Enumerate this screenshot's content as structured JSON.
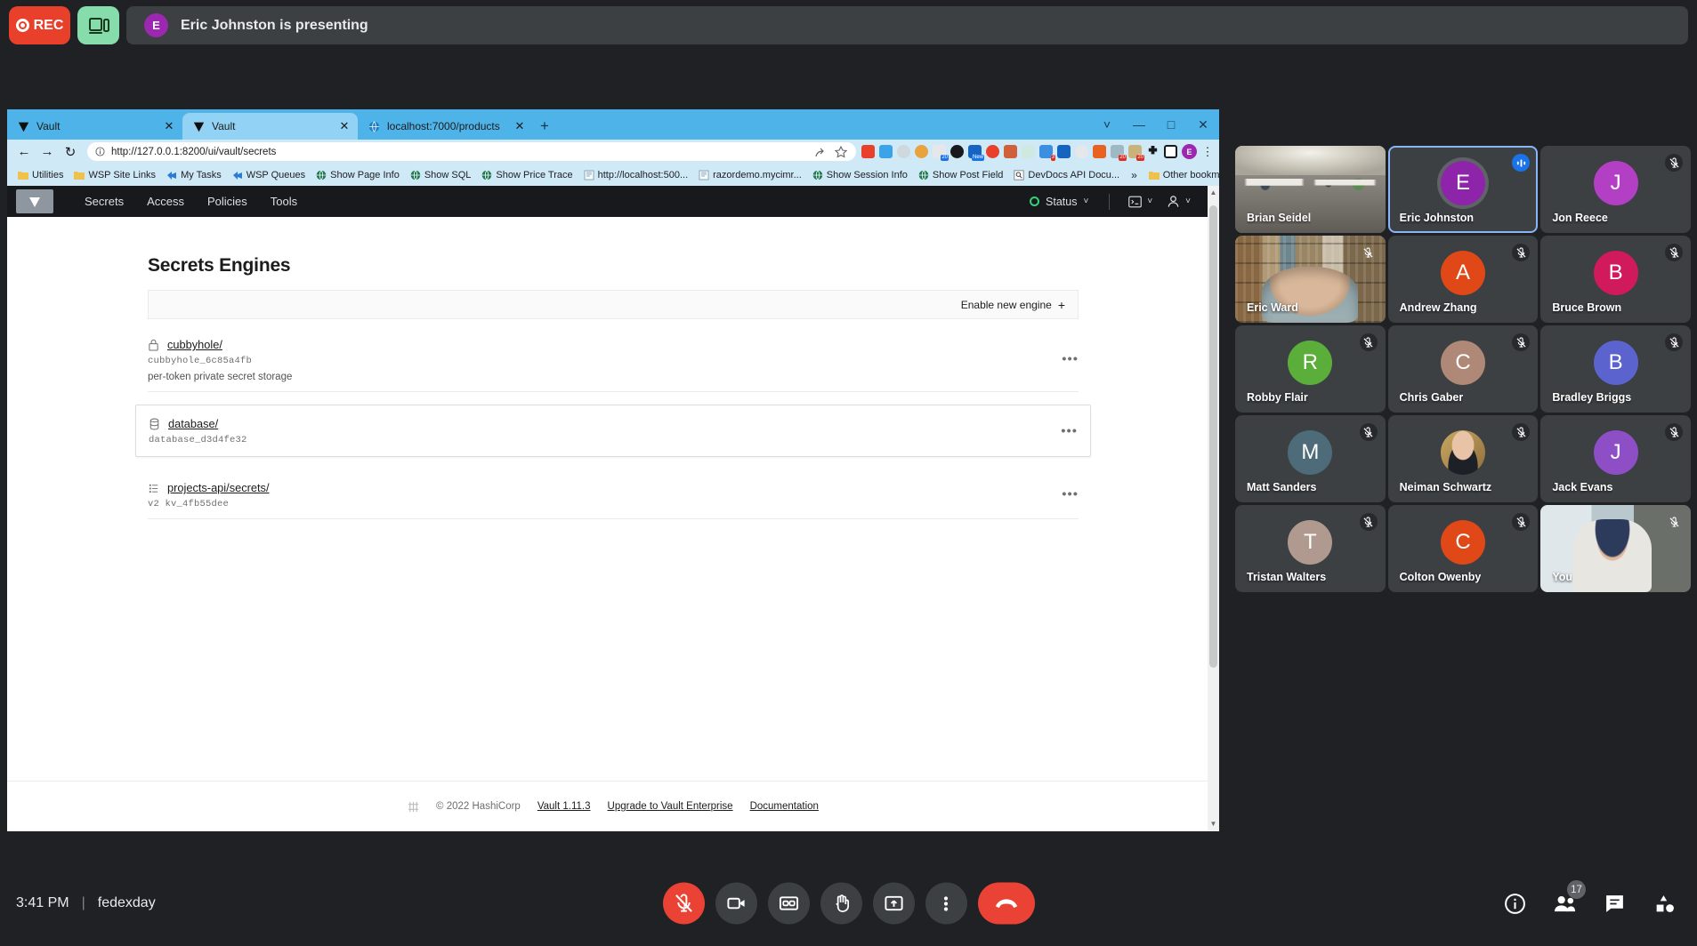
{
  "top_bar": {
    "rec_label": "REC",
    "rec_icon": "record-dot-icon",
    "present_icon": "present-screen-icon",
    "presenter_initial": "E",
    "presenting_text": "Eric Johnston is presenting",
    "rec_color": "#e8402b",
    "present_color": "#86ddab"
  },
  "browser": {
    "tabs": [
      {
        "title": "Vault",
        "favicon": "vault-logo-icon",
        "active": false
      },
      {
        "title": "Vault",
        "favicon": "vault-logo-icon",
        "active": true
      },
      {
        "title": "localhost:7000/products",
        "favicon": "globe-icon",
        "active": false
      }
    ],
    "new_tab_label": "+",
    "window_controls": [
      "chevron-down-icon",
      "minimize-icon",
      "maximize-icon",
      "close-icon"
    ],
    "nav": {
      "back_icon": "arrow-left-icon",
      "forward_icon": "arrow-right-icon",
      "reload_icon": "reload-icon"
    },
    "url": "http://127.0.0.1:8200/ui/vault/secrets",
    "url_info_icon": "info-circle-icon",
    "url_actions": [
      "share-icon",
      "bookmark-star-icon"
    ],
    "profile_initial": "E",
    "bookmarks": [
      {
        "label": "Utilities",
        "icon": "folder-icon"
      },
      {
        "label": "WSP Site Links",
        "icon": "folder-icon"
      },
      {
        "label": "My Tasks",
        "icon": "sharepoint-icon"
      },
      {
        "label": "WSP Queues",
        "icon": "sharepoint-icon"
      },
      {
        "label": "Show Page Info",
        "icon": "globe-icon"
      },
      {
        "label": "Show SQL",
        "icon": "globe-icon"
      },
      {
        "label": "Show Price Trace",
        "icon": "globe-icon"
      },
      {
        "label": "http://localhost:500...",
        "icon": "document-icon"
      },
      {
        "label": "razordemo.mycimr...",
        "icon": "document-icon"
      },
      {
        "label": "Show Session Info",
        "icon": "globe-icon"
      },
      {
        "label": "Show Post Field",
        "icon": "globe-icon"
      },
      {
        "label": "DevDocs API Docu...",
        "icon": "search-doc-icon"
      }
    ],
    "bookmarks_overflow": "»",
    "other_bookmarks": {
      "label": "Other bookmarks",
      "icon": "folder-icon"
    },
    "extension_badges": [
      "20",
      "New",
      "3",
      "20",
      "20"
    ]
  },
  "vault": {
    "logo_icon": "vault-triangle-icon",
    "nav_links": [
      "Secrets",
      "Access",
      "Policies",
      "Tools"
    ],
    "status": {
      "label": "Status",
      "dot_color": "#2fd37a",
      "chevron": "chevron-down-icon"
    },
    "console_icon": "terminal-icon",
    "user_icon": "user-icon",
    "page_title": "Secrets Engines",
    "enable_button": {
      "label": "Enable new engine",
      "plus": "+"
    },
    "engines": [
      {
        "name": "cubbyhole/",
        "icon": "lock-icon",
        "accessor": "cubbyhole_6c85a4fb",
        "description": "per-token private secret storage",
        "menu": "•••",
        "selected": false
      },
      {
        "name": "database/",
        "icon": "database-icon",
        "accessor": "database_d3d4fe32",
        "description": "",
        "menu": "•••",
        "selected": true
      },
      {
        "name": "projects-api/secrets/",
        "icon": "kv-list-icon",
        "accessor": "v2  kv_4fb55dee",
        "description": "",
        "menu": "•••",
        "selected": false
      }
    ],
    "footer": {
      "logo_icon": "hashicorp-logo-icon",
      "copyright": "© 2022 HashiCorp",
      "version": "Vault 1.11.3",
      "upgrade": "Upgrade to Vault Enterprise",
      "documentation": "Documentation"
    }
  },
  "participants": [
    {
      "name": "Brian Seidel",
      "type": "video",
      "photo": "ph-office",
      "muted": false,
      "speaking": false,
      "show_mic": false
    },
    {
      "name": "Eric Johnston",
      "type": "avatar",
      "initial": "E",
      "color": "#8e24aa",
      "speaking": true,
      "show_mic": true,
      "mic_active": true
    },
    {
      "name": "Jon Reece",
      "type": "avatar",
      "initial": "J",
      "color": "#b23fc4",
      "muted": true,
      "show_mic": true
    },
    {
      "name": "Eric Ward",
      "type": "video",
      "photo": "ph-bookshelf",
      "muted": true,
      "show_mic": true,
      "mic_on_photo": true
    },
    {
      "name": "Andrew Zhang",
      "type": "avatar",
      "initial": "A",
      "color": "#e14817",
      "muted": true,
      "show_mic": true
    },
    {
      "name": "Bruce Brown",
      "type": "avatar",
      "initial": "B",
      "color": "#d01a5b",
      "muted": true,
      "show_mic": true
    },
    {
      "name": "Robby Flair",
      "type": "avatar",
      "initial": "R",
      "color": "#5cae3a",
      "muted": true,
      "show_mic": true
    },
    {
      "name": "Chris Gaber",
      "type": "avatar",
      "initial": "C",
      "color": "#b08878",
      "muted": true,
      "show_mic": true
    },
    {
      "name": "Bradley Briggs",
      "type": "avatar",
      "initial": "B",
      "color": "#5b63cf",
      "muted": true,
      "show_mic": true
    },
    {
      "name": "Matt Sanders",
      "type": "avatar",
      "initial": "M",
      "color": "#4d6b78",
      "muted": true,
      "show_mic": true
    },
    {
      "name": "Neiman Schwartz",
      "type": "photo-avatar",
      "photo": "ph-headshot",
      "muted": true,
      "show_mic": true
    },
    {
      "name": "Jack Evans",
      "type": "avatar",
      "initial": "J",
      "color": "#8e4ec6",
      "muted": true,
      "show_mic": true
    },
    {
      "name": "Tristan Walters",
      "type": "avatar",
      "initial": "T",
      "color": "#b09a90",
      "muted": true,
      "show_mic": true
    },
    {
      "name": "Colton Owenby",
      "type": "avatar",
      "initial": "C",
      "color": "#e14817",
      "muted": true,
      "show_mic": true
    },
    {
      "name": "You",
      "type": "video",
      "photo": "ph-room",
      "muted": true,
      "show_mic": true,
      "mic_on_photo": true
    }
  ],
  "bottom_bar": {
    "time": "3:41 PM",
    "separator": "|",
    "meeting_name": "fedexday",
    "controls": [
      {
        "name": "microphone-muted-button",
        "icon": "mic-off-icon",
        "style": "danger"
      },
      {
        "name": "camera-button",
        "icon": "camera-icon",
        "style": "normal"
      },
      {
        "name": "captions-button",
        "icon": "closed-captions-icon",
        "style": "normal"
      },
      {
        "name": "raise-hand-button",
        "icon": "hand-icon",
        "style": "normal"
      },
      {
        "name": "present-screen-button",
        "icon": "present-screen-icon",
        "style": "normal"
      },
      {
        "name": "more-options-button",
        "icon": "more-vertical-icon",
        "style": "normal"
      },
      {
        "name": "leave-call-button",
        "icon": "end-call-icon",
        "style": "hangup"
      }
    ],
    "right_controls": [
      {
        "name": "meeting-details-button",
        "icon": "info-circle-icon",
        "badge": ""
      },
      {
        "name": "participants-button",
        "icon": "people-icon",
        "badge": "17"
      },
      {
        "name": "chat-button",
        "icon": "chat-bubble-icon",
        "badge": ""
      },
      {
        "name": "activities-button",
        "icon": "activities-shapes-icon",
        "badge": ""
      }
    ]
  }
}
